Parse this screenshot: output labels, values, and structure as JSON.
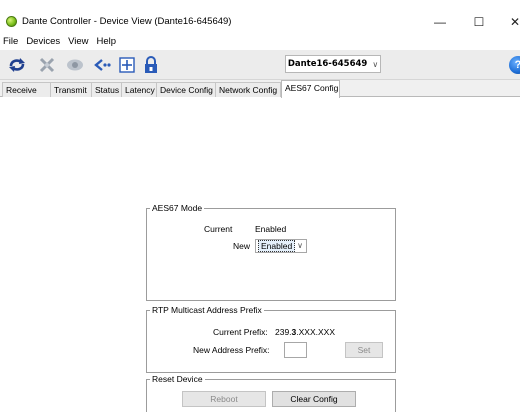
{
  "window": {
    "title": "Dante Controller - Device View (Dante16-645649)",
    "minimize": "—",
    "maximize": "☐",
    "close": "✕"
  },
  "menu": [
    "File",
    "Devices",
    "View",
    "Help"
  ],
  "toolbar": {
    "device_selector": "Dante16-645649",
    "help_glyph": "?",
    "icons": [
      "refresh-icon",
      "tools-icon",
      "identify-icon",
      "network-icon",
      "add-icon",
      "lock-icon"
    ]
  },
  "tabs": [
    {
      "label": "Receive",
      "active": false
    },
    {
      "label": "Transmit",
      "active": false
    },
    {
      "label": "Status",
      "active": false
    },
    {
      "label": "Latency",
      "active": false
    },
    {
      "label": "Device Config",
      "active": false
    },
    {
      "label": "Network Config",
      "active": false
    },
    {
      "label": "AES67 Config",
      "active": true
    }
  ],
  "aes67_mode": {
    "legend": "AES67 Mode",
    "current_label": "Current",
    "current_value": "Enabled",
    "new_label": "New",
    "new_value": "Enabled"
  },
  "rtp_prefix": {
    "legend": "RTP Multicast Address Prefix",
    "current_label": "Current Prefix:",
    "current_value_pre": "239.",
    "current_value_bold": "3",
    "current_value_post": ".XXX.XXX",
    "new_label": "New Address Prefix:",
    "new_value": "",
    "set_label": "Set"
  },
  "reset_device": {
    "legend": "Reset Device",
    "reboot_label": "Reboot",
    "clear_config_label": "Clear Config"
  }
}
